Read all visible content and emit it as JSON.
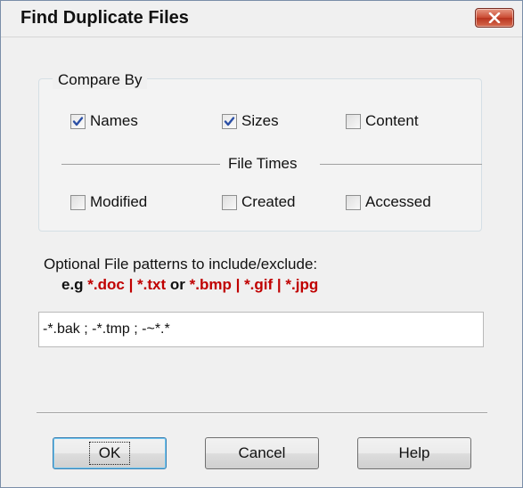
{
  "window": {
    "title": "Find Duplicate Files",
    "close_icon": "close-icon"
  },
  "compare_by": {
    "label": "Compare By",
    "options": [
      {
        "label": "Names",
        "checked": true
      },
      {
        "label": "Sizes",
        "checked": true
      },
      {
        "label": "Content",
        "checked": false
      }
    ]
  },
  "file_times": {
    "label": "File Times",
    "options": [
      {
        "label": "Modified",
        "checked": false
      },
      {
        "label": "Created",
        "checked": false
      },
      {
        "label": "Accessed",
        "checked": false
      }
    ]
  },
  "patterns": {
    "label": "Optional File patterns to include/exclude:",
    "example_prefix": "e.g ",
    "example_1": "*.doc | *.txt",
    "example_sep": " or ",
    "example_2": "*.bmp | *.gif | *.jpg",
    "value": "-*.bak ; -*.tmp ; -~*.*"
  },
  "buttons": {
    "ok": "OK",
    "cancel": "Cancel",
    "help": "Help"
  },
  "colors": {
    "example_accent": "#c00000",
    "close_button": "#c94a32"
  }
}
